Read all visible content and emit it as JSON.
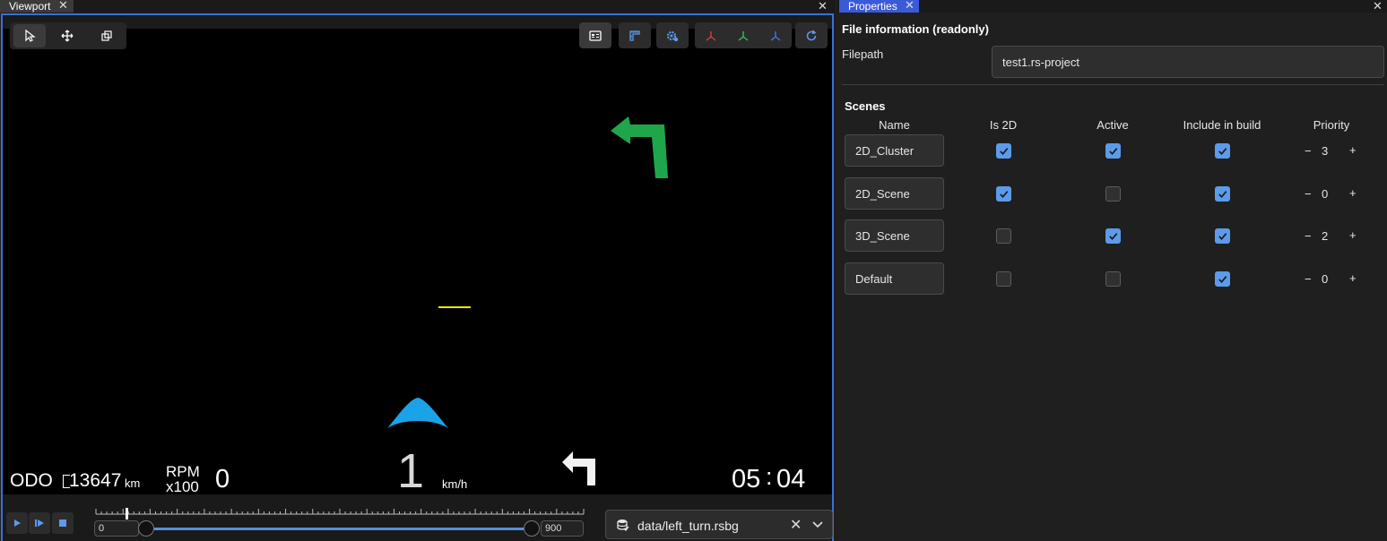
{
  "viewport": {
    "tab_label": "Viewport",
    "close_glyph": "✕",
    "toolbar_left": [
      {
        "name": "select-tool-button",
        "icon": "cursor-icon"
      },
      {
        "name": "move-tool-button",
        "icon": "move-arrows-icon"
      },
      {
        "name": "scale-tool-button",
        "icon": "scale-squares-icon"
      }
    ],
    "toolbar_right": [
      {
        "name": "preview-button",
        "icon": "preview-window-icon"
      },
      {
        "name": "ruler-button",
        "icon": "ruler-icon"
      },
      {
        "name": "settings-button",
        "icon": "gear-cog-icon"
      },
      {
        "name": "axis-x-button",
        "icon": "axis-red-icon"
      },
      {
        "name": "axis-y-button",
        "icon": "axis-green-icon"
      },
      {
        "name": "axis-z-button",
        "icon": "axis-blue-icon"
      },
      {
        "name": "refresh-button",
        "icon": "refresh-icon"
      }
    ],
    "hud": {
      "odo_label": "ODO",
      "odo_value": "13647",
      "odo_unit": "km",
      "rpm_label_top": "RPM",
      "rpm_label_bottom": "x100",
      "rpm_value": "0",
      "speed_value": "1",
      "speed_unit": "km/h",
      "clock_hours": "05",
      "clock_sep": ":",
      "clock_minutes": "04"
    },
    "colors": {
      "accent_border": "#3b6fd8",
      "turn_arrow_green": "#1fa64a",
      "car_blue": "#1aa3e8",
      "marker_yellow": "#f2e600"
    },
    "playback": {
      "play": "play-icon",
      "step": "step-forward-icon",
      "stop": "stop-icon",
      "range_min": "0",
      "range_max": "900",
      "start_fraction": 0.0,
      "end_fraction": 1.0,
      "file_name": "data/left_turn.rsbg",
      "file_icon": "database-icon",
      "clear_glyph": "✕",
      "dropdown_icon": "chevron-down-icon"
    }
  },
  "properties": {
    "tab_label": "Properties",
    "close_glyph": "✕",
    "file_info_title": "File information (readonly)",
    "filepath_label": "Filepath",
    "filepath_value": "test1.rs-project",
    "scenes_title": "Scenes",
    "columns": [
      "Name",
      "Is 2D",
      "Active",
      "Include in build",
      "Priority"
    ],
    "scenes": [
      {
        "name": "2D_Cluster",
        "is2d": true,
        "active": true,
        "include": true,
        "priority": "3"
      },
      {
        "name": "2D_Scene",
        "is2d": true,
        "active": false,
        "include": true,
        "priority": "0"
      },
      {
        "name": "3D_Scene",
        "is2d": false,
        "active": true,
        "include": true,
        "priority": "2"
      },
      {
        "name": "Default",
        "is2d": false,
        "active": false,
        "include": true,
        "priority": "0"
      }
    ],
    "minus_glyph": "−",
    "plus_glyph": "+",
    "check_color": "#5b9bea"
  }
}
